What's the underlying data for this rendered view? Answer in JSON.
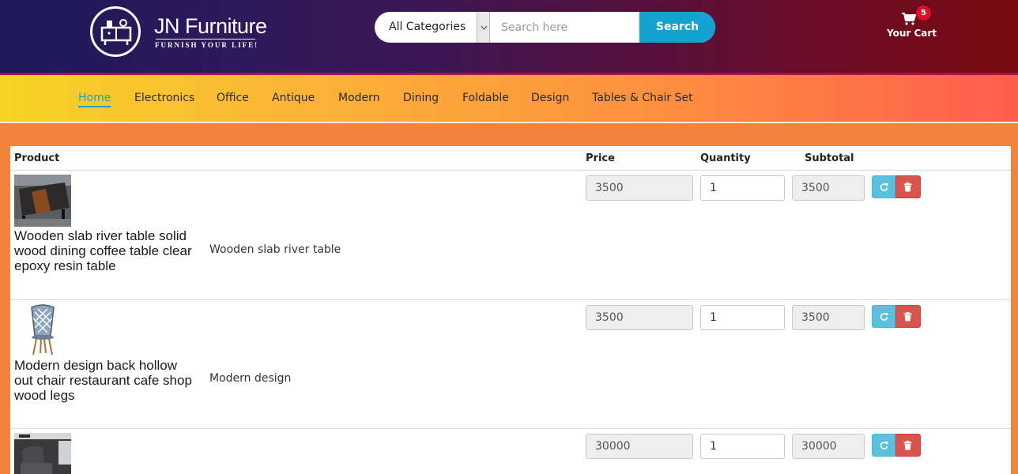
{
  "brand": {
    "name": "JN Furniture",
    "tagline": "FURNISH YOUR LIFE!"
  },
  "search": {
    "category": "All Categories",
    "placeholder": "Search here",
    "button": "Search"
  },
  "cart": {
    "count": "5",
    "label": "Your Cart"
  },
  "nav": {
    "items": [
      {
        "label": "Home",
        "active": true
      },
      {
        "label": "Electronics"
      },
      {
        "label": "Office"
      },
      {
        "label": "Antique"
      },
      {
        "label": "Modern"
      },
      {
        "label": "Dining"
      },
      {
        "label": "Foldable"
      },
      {
        "label": "Design"
      },
      {
        "label": "Tables & Chair Set"
      }
    ]
  },
  "table": {
    "headers": {
      "product": "Product",
      "price": "Price",
      "quantity": "Quantity",
      "subtotal": "Subtotal"
    },
    "rows": [
      {
        "name": "Wooden slab river table solid wood dining coffee table clear epoxy resin table",
        "description": "Wooden slab river table",
        "price": "3500",
        "quantity": "1",
        "subtotal": "3500",
        "image_icon": "river-table-image"
      },
      {
        "name": "Modern design back hollow out chair restaurant cafe shop wood legs",
        "description": "Modern design",
        "price": "3500",
        "quantity": "1",
        "subtotal": "3500",
        "image_icon": "hollow-chair-image"
      },
      {
        "name": "",
        "description": "",
        "price": "30000",
        "quantity": "1",
        "subtotal": "30000",
        "image_icon": "armchair-room-image"
      }
    ]
  },
  "colors": {
    "accent": "#13a3d0",
    "refresh": "#5bc0de",
    "delete": "#d9534f",
    "badge": "#d8122a"
  },
  "icons": {
    "cart": "cart-icon",
    "refresh": "refresh-icon",
    "delete": "trash-icon",
    "dropdown": "chevron-down-icon"
  }
}
